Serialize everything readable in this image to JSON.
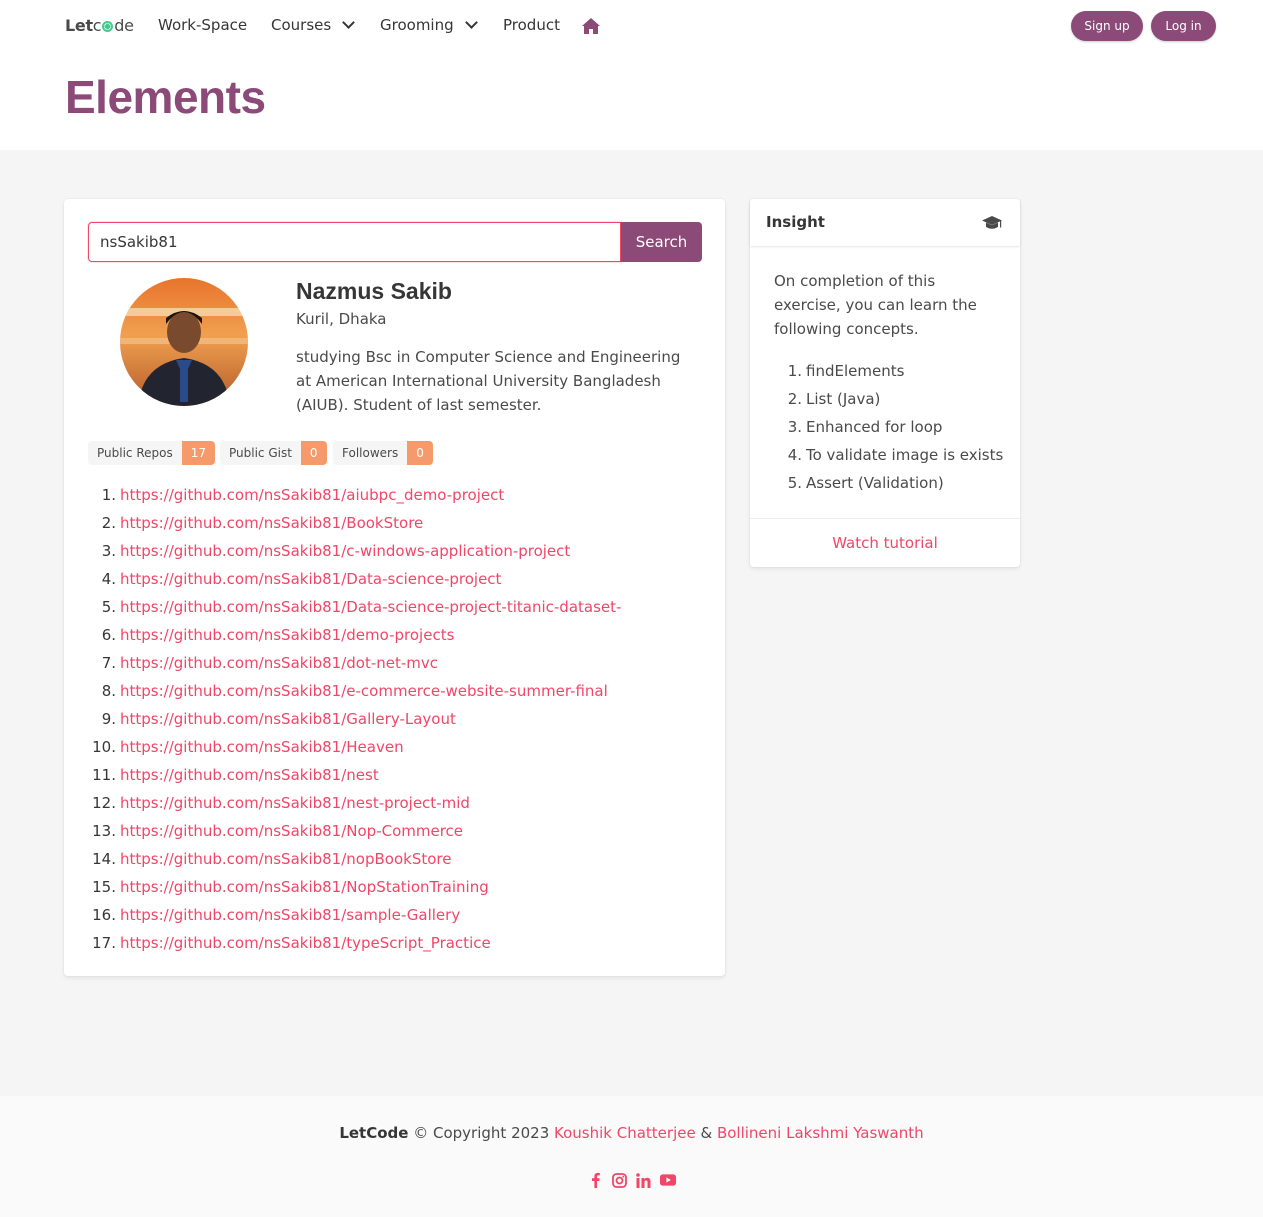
{
  "nav": {
    "brand_bold": "Let",
    "brand_thin": "de",
    "items": [
      {
        "label": "Work-Space"
      },
      {
        "label": "Courses"
      },
      {
        "label": "Grooming"
      },
      {
        "label": "Product"
      }
    ],
    "signup_label": "Sign up",
    "login_label": "Log in"
  },
  "page_title": "Elements",
  "search": {
    "value": "nsSakib81",
    "button_label": "Search"
  },
  "profile": {
    "name": "Nazmus Sakib",
    "location": "Kuril, Dhaka",
    "bio": "studying Bsc in Computer Science and Engineering at American International University Bangladesh (AIUB). Student of last semester.",
    "stats": [
      {
        "label": "Public Repos",
        "value": "17"
      },
      {
        "label": "Public Gist",
        "value": "0"
      },
      {
        "label": "Followers",
        "value": "0"
      }
    ]
  },
  "repos": [
    "https://github.com/nsSakib81/aiubpc_demo-project",
    "https://github.com/nsSakib81/BookStore",
    "https://github.com/nsSakib81/c-windows-application-project",
    "https://github.com/nsSakib81/Data-science-project",
    "https://github.com/nsSakib81/Data-science-project-titanic-dataset-",
    "https://github.com/nsSakib81/demo-projects",
    "https://github.com/nsSakib81/dot-net-mvc",
    "https://github.com/nsSakib81/e-commerce-website-summer-final",
    "https://github.com/nsSakib81/Gallery-Layout",
    "https://github.com/nsSakib81/Heaven",
    "https://github.com/nsSakib81/nest",
    "https://github.com/nsSakib81/nest-project-mid",
    "https://github.com/nsSakib81/Nop-Commerce",
    "https://github.com/nsSakib81/nopBookStore",
    "https://github.com/nsSakib81/NopStationTraining",
    "https://github.com/nsSakib81/sample-Gallery",
    "https://github.com/nsSakib81/typeScript_Practice"
  ],
  "insight": {
    "title": "Insight",
    "text": "On completion of this exercise, you can learn the following concepts.",
    "items": [
      "findElements",
      "List (Java)",
      "Enhanced for loop",
      "To validate image is exists",
      "Assert (Validation)"
    ],
    "footer_link": "Watch tutorial"
  },
  "footer": {
    "brand": "LetCode",
    "copyright_text": " © Copyright 2023 ",
    "author1": "Koushik Chatterjee",
    "amp": " & ",
    "author2": "Bollineni Lakshmi Yaswanth",
    "socials": [
      "facebook-icon",
      "instagram-icon",
      "linkedin-icon",
      "youtube-icon"
    ]
  },
  "colors": {
    "primary": "#8b4a77",
    "link": "#f14668",
    "tag_number": "#f79a6b",
    "background": "#f5f5f5"
  }
}
